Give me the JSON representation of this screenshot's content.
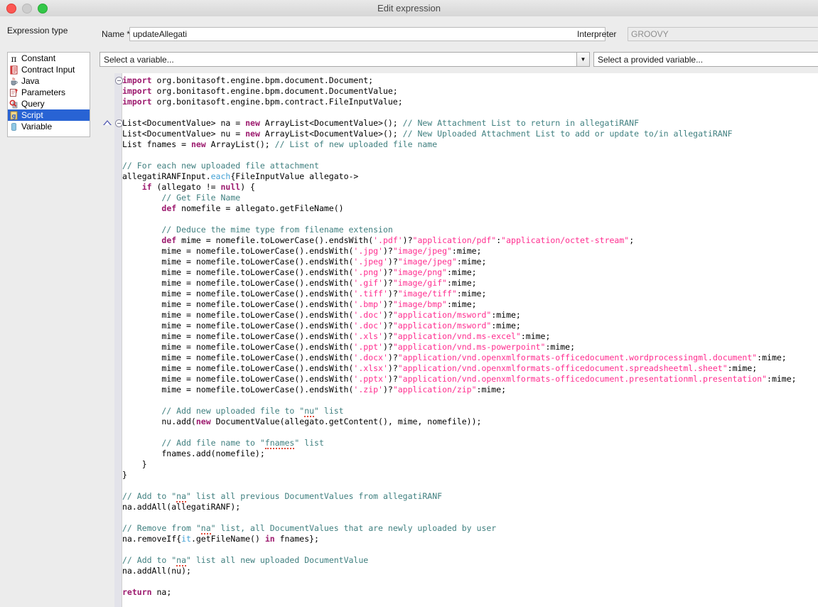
{
  "window": {
    "title": "Edit expression",
    "controls": [
      {
        "name": "close-button",
        "color": "#fc5753"
      },
      {
        "name": "minimize-button",
        "color": "#cdcdcd"
      },
      {
        "name": "maximize-button",
        "color": "#33c748"
      }
    ]
  },
  "sidebar": {
    "heading": "Expression type",
    "items": [
      {
        "label": "Constant",
        "icon": "pi-icon",
        "selected": false
      },
      {
        "label": "Contract Input",
        "icon": "contract-document-icon",
        "selected": false
      },
      {
        "label": "Java",
        "icon": "java-cup-icon",
        "selected": false
      },
      {
        "label": "Parameters",
        "icon": "parameters-icon",
        "selected": false
      },
      {
        "label": "Query",
        "icon": "magnifier-query-icon",
        "selected": false
      },
      {
        "label": "Script",
        "icon": "script-page-icon",
        "selected": true
      },
      {
        "label": "Variable",
        "icon": "variable-cylinder-icon",
        "selected": false
      }
    ]
  },
  "form": {
    "name_label": "Name *",
    "name_value": "updateAllegati",
    "name_placeholder": "",
    "interpreter_label": "Interpreter",
    "interpreter_value": "GROOVY",
    "variable_select": "Select a variable...",
    "variable_select_arrow": "▼",
    "provided_variable_select": "Select a provided variable..."
  },
  "editor": {
    "language": "groovy",
    "lines": [
      [
        {
          "t": "import ",
          "c": "k"
        },
        {
          "t": "org.bonitasoft.engine.bpm.document.Document;",
          "c": "p"
        }
      ],
      [
        {
          "t": "import ",
          "c": "k"
        },
        {
          "t": "org.bonitasoft.engine.bpm.document.DocumentValue;",
          "c": "p"
        }
      ],
      [
        {
          "t": "import ",
          "c": "k"
        },
        {
          "t": "org.bonitasoft.engine.bpm.contract.FileInputValue;",
          "c": "p"
        }
      ],
      [],
      [
        {
          "t": "List<DocumentValue> na = ",
          "c": "p"
        },
        {
          "t": "new ",
          "c": "k"
        },
        {
          "t": "ArrayList<DocumentValue>(); ",
          "c": "p"
        },
        {
          "t": "// New Attachment List to return in allegatiRANF",
          "c": "c"
        }
      ],
      [
        {
          "t": "List<DocumentValue> nu = ",
          "c": "p"
        },
        {
          "t": "new ",
          "c": "k"
        },
        {
          "t": "ArrayList<DocumentValue>(); ",
          "c": "p"
        },
        {
          "t": "// New Uploaded Attachment List to add or update to/in allegatiRANF",
          "c": "c"
        }
      ],
      [
        {
          "t": "List fnames = ",
          "c": "p"
        },
        {
          "t": "new ",
          "c": "k"
        },
        {
          "t": "ArrayList(); ",
          "c": "p"
        },
        {
          "t": "// List of new uploaded file name",
          "c": "c"
        }
      ],
      [],
      [
        {
          "t": "// For each new uploaded file attachment",
          "c": "c"
        }
      ],
      [
        {
          "t": "allegatiRANFInput.",
          "c": "p"
        },
        {
          "t": "each",
          "c": "m"
        },
        {
          "t": "{FileInputValue allegato->",
          "c": "p"
        }
      ],
      [
        {
          "t": "    if ",
          "c": "k"
        },
        {
          "t": "(allegato != ",
          "c": "p"
        },
        {
          "t": "null",
          "c": "k"
        },
        {
          "t": ") {",
          "c": "p"
        }
      ],
      [
        {
          "t": "        // Get File Name",
          "c": "c"
        }
      ],
      [
        {
          "t": "        ",
          "c": "p"
        },
        {
          "t": "def ",
          "c": "k"
        },
        {
          "t": "nomefile = allegato.getFileName()",
          "c": "p"
        }
      ],
      [],
      [
        {
          "t": "        // Deduce the mime type from filename extension",
          "c": "c"
        }
      ],
      [
        {
          "t": "        ",
          "c": "p"
        },
        {
          "t": "def ",
          "c": "k"
        },
        {
          "t": "mime = nomefile.toLowerCase().endsWith(",
          "c": "p"
        },
        {
          "t": "'.pdf'",
          "c": "s"
        },
        {
          "t": ")?",
          "c": "p"
        },
        {
          "t": "\"application/pdf\"",
          "c": "s"
        },
        {
          "t": ":",
          "c": "p"
        },
        {
          "t": "\"application/octet-stream\"",
          "c": "s"
        },
        {
          "t": ";",
          "c": "p"
        }
      ],
      [
        {
          "t": "        mime = nomefile.toLowerCase().endsWith(",
          "c": "p"
        },
        {
          "t": "'.jpg'",
          "c": "s"
        },
        {
          "t": ")?",
          "c": "p"
        },
        {
          "t": "\"image/jpeg\"",
          "c": "s"
        },
        {
          "t": ":mime;",
          "c": "p"
        }
      ],
      [
        {
          "t": "        mime = nomefile.toLowerCase().endsWith(",
          "c": "p"
        },
        {
          "t": "'.jpeg'",
          "c": "s"
        },
        {
          "t": ")?",
          "c": "p"
        },
        {
          "t": "\"image/jpeg\"",
          "c": "s"
        },
        {
          "t": ":mime;",
          "c": "p"
        }
      ],
      [
        {
          "t": "        mime = nomefile.toLowerCase().endsWith(",
          "c": "p"
        },
        {
          "t": "'.png'",
          "c": "s"
        },
        {
          "t": ")?",
          "c": "p"
        },
        {
          "t": "\"image/png\"",
          "c": "s"
        },
        {
          "t": ":mime;",
          "c": "p"
        }
      ],
      [
        {
          "t": "        mime = nomefile.toLowerCase().endsWith(",
          "c": "p"
        },
        {
          "t": "'.gif'",
          "c": "s"
        },
        {
          "t": ")?",
          "c": "p"
        },
        {
          "t": "\"image/gif\"",
          "c": "s"
        },
        {
          "t": ":mime;",
          "c": "p"
        }
      ],
      [
        {
          "t": "        mime = nomefile.toLowerCase().endsWith(",
          "c": "p"
        },
        {
          "t": "'.tiff'",
          "c": "s"
        },
        {
          "t": ")?",
          "c": "p"
        },
        {
          "t": "\"image/tiff\"",
          "c": "s"
        },
        {
          "t": ":mime;",
          "c": "p"
        }
      ],
      [
        {
          "t": "        mime = nomefile.toLowerCase().endsWith(",
          "c": "p"
        },
        {
          "t": "'.bmp'",
          "c": "s"
        },
        {
          "t": ")?",
          "c": "p"
        },
        {
          "t": "\"image/bmp\"",
          "c": "s"
        },
        {
          "t": ":mime;",
          "c": "p"
        }
      ],
      [
        {
          "t": "        mime = nomefile.toLowerCase().endsWith(",
          "c": "p"
        },
        {
          "t": "'.doc'",
          "c": "s"
        },
        {
          "t": ")?",
          "c": "p"
        },
        {
          "t": "\"application/msword\"",
          "c": "s"
        },
        {
          "t": ":mime;",
          "c": "p"
        }
      ],
      [
        {
          "t": "        mime = nomefile.toLowerCase().endsWith(",
          "c": "p"
        },
        {
          "t": "'.doc'",
          "c": "s"
        },
        {
          "t": ")?",
          "c": "p"
        },
        {
          "t": "\"application/msword\"",
          "c": "s"
        },
        {
          "t": ":mime;",
          "c": "p"
        }
      ],
      [
        {
          "t": "        mime = nomefile.toLowerCase().endsWith(",
          "c": "p"
        },
        {
          "t": "'.xls'",
          "c": "s"
        },
        {
          "t": ")?",
          "c": "p"
        },
        {
          "t": "\"application/vnd.ms-excel\"",
          "c": "s"
        },
        {
          "t": ":mime;",
          "c": "p"
        }
      ],
      [
        {
          "t": "        mime = nomefile.toLowerCase().endsWith(",
          "c": "p"
        },
        {
          "t": "'.ppt'",
          "c": "s"
        },
        {
          "t": ")?",
          "c": "p"
        },
        {
          "t": "\"application/vnd.ms-powerpoint\"",
          "c": "s"
        },
        {
          "t": ":mime;",
          "c": "p"
        }
      ],
      [
        {
          "t": "        mime = nomefile.toLowerCase().endsWith(",
          "c": "p"
        },
        {
          "t": "'.docx'",
          "c": "s"
        },
        {
          "t": ")?",
          "c": "p"
        },
        {
          "t": "\"application/vnd.openxmlformats-officedocument.wordprocessingml.document\"",
          "c": "s"
        },
        {
          "t": ":mime;",
          "c": "p"
        }
      ],
      [
        {
          "t": "        mime = nomefile.toLowerCase().endsWith(",
          "c": "p"
        },
        {
          "t": "'.xlsx'",
          "c": "s"
        },
        {
          "t": ")?",
          "c": "p"
        },
        {
          "t": "\"application/vnd.openxmlformats-officedocument.spreadsheetml.sheet\"",
          "c": "s"
        },
        {
          "t": ":mime;",
          "c": "p"
        }
      ],
      [
        {
          "t": "        mime = nomefile.toLowerCase().endsWith(",
          "c": "p"
        },
        {
          "t": "'.pptx'",
          "c": "s"
        },
        {
          "t": ")?",
          "c": "p"
        },
        {
          "t": "\"application/vnd.openxmlformats-officedocument.presentationml.presentation\"",
          "c": "s"
        },
        {
          "t": ":mime;",
          "c": "p"
        }
      ],
      [
        {
          "t": "        mime = nomefile.toLowerCase().endsWith(",
          "c": "p"
        },
        {
          "t": "'.zip'",
          "c": "s"
        },
        {
          "t": ")?",
          "c": "p"
        },
        {
          "t": "\"application/zip\"",
          "c": "s"
        },
        {
          "t": ":mime;",
          "c": "p"
        }
      ],
      [],
      [
        {
          "t": "        // Add new uploaded file to \"",
          "c": "c"
        },
        {
          "t": "nu",
          "c": "c",
          "sq": true
        },
        {
          "t": "\" list",
          "c": "c"
        }
      ],
      [
        {
          "t": "        nu.add(",
          "c": "p"
        },
        {
          "t": "new ",
          "c": "k"
        },
        {
          "t": "DocumentValue(allegato.getContent(), mime, nomefile));",
          "c": "p"
        }
      ],
      [],
      [
        {
          "t": "        // Add file name to \"",
          "c": "c"
        },
        {
          "t": "fnames",
          "c": "c",
          "sq": true
        },
        {
          "t": "\" list",
          "c": "c"
        }
      ],
      [
        {
          "t": "        fnames.add(nomefile);",
          "c": "p"
        }
      ],
      [
        {
          "t": "    }",
          "c": "p"
        }
      ],
      [
        {
          "t": "}",
          "c": "p"
        }
      ],
      [],
      [
        {
          "t": "// Add to \"",
          "c": "c"
        },
        {
          "t": "na",
          "c": "c",
          "sq": true
        },
        {
          "t": "\" list all previous DocumentValues from allegatiRANF",
          "c": "c"
        }
      ],
      [
        {
          "t": "na.addAll(allegatiRANF);",
          "c": "p"
        }
      ],
      [],
      [
        {
          "t": "// Remove from \"",
          "c": "c"
        },
        {
          "t": "na",
          "c": "c",
          "sq": true
        },
        {
          "t": "\" list, all DocumentValues that are newly uploaded by user",
          "c": "c"
        }
      ],
      [
        {
          "t": "na.removeIf{",
          "c": "p"
        },
        {
          "t": "it",
          "c": "m"
        },
        {
          "t": ".getFileName() ",
          "c": "p"
        },
        {
          "t": "in ",
          "c": "k"
        },
        {
          "t": "fnames};",
          "c": "p"
        }
      ],
      [],
      [
        {
          "t": "// Add to \"",
          "c": "c"
        },
        {
          "t": "na",
          "c": "c",
          "sq": true
        },
        {
          "t": "\" list all new uploaded DocumentValue",
          "c": "c"
        }
      ],
      [
        {
          "t": "na.addAll(nu);",
          "c": "p"
        }
      ],
      [],
      [
        {
          "t": "return ",
          "c": "k"
        },
        {
          "t": "na;",
          "c": "p"
        }
      ]
    ],
    "fold_markers_on_lines": [
      0,
      4
    ],
    "annotation_markers_on_lines": [
      4
    ]
  }
}
